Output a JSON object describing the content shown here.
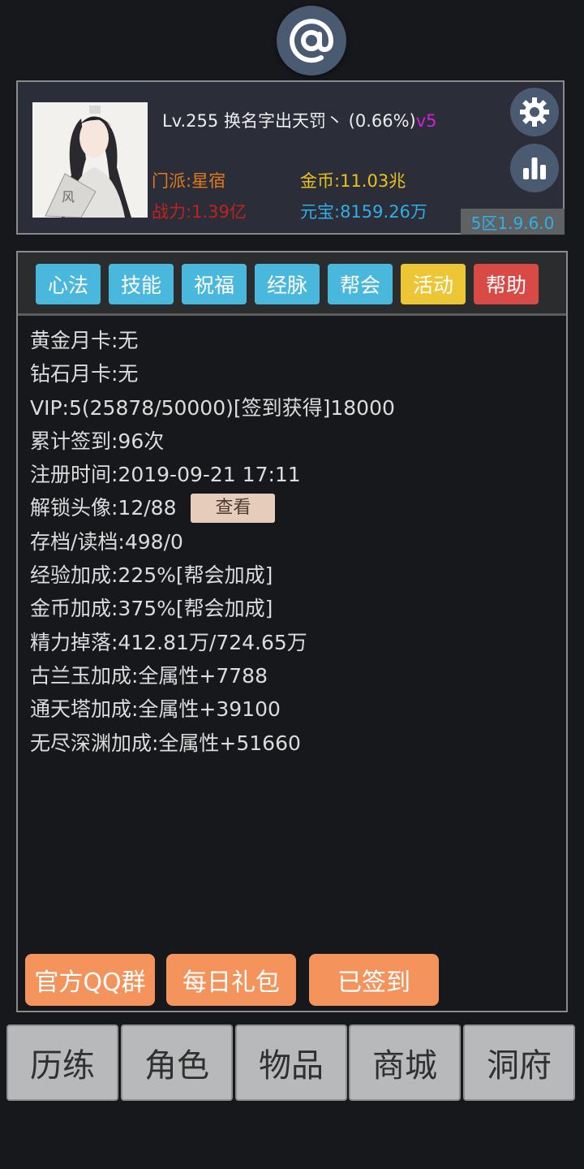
{
  "header": {
    "top_icon": "at-sign-icon"
  },
  "profile": {
    "level": "Lv.255",
    "name": "换名字出天罚丶",
    "progress": "(0.66%)",
    "vip": "v5",
    "sect": "门派:星宿",
    "gold": "金币:11.03兆",
    "power": "战力:1.39亿",
    "yuanbao": "元宝:8159.26万",
    "version": "5区1.9.6.0",
    "settings_icon": "gear-icon",
    "stats_icon": "bar-chart-icon",
    "avatar_fan_char": "风"
  },
  "tabs": [
    {
      "label": "心法",
      "color": "#4ab8dc"
    },
    {
      "label": "技能",
      "color": "#4ab8dc"
    },
    {
      "label": "祝福",
      "color": "#4ab8dc"
    },
    {
      "label": "经脉",
      "color": "#4ab8dc"
    },
    {
      "label": "帮会",
      "color": "#4ab8dc"
    },
    {
      "label": "活动",
      "color": "#ecc634"
    },
    {
      "label": "帮助",
      "color": "#d84a45"
    }
  ],
  "info": [
    "黄金月卡:无",
    "钻石月卡:无",
    "VIP:5(25878/50000)[签到获得]18000",
    "累计签到:96次",
    "注册时间:2019-09-21 17:11",
    "解锁头像:12/88",
    "存档/读档:498/0",
    "经验加成:225%[帮会加成]",
    "金币加成:375%[帮会加成]",
    "精力掉落:412.81万/724.65万",
    "古兰玉加成:全属性+7788",
    "通天塔加成:全属性+39100",
    "无尽深渊加成:全属性+51660"
  ],
  "view_button": "查看",
  "actions": {
    "qq_group": "官方QQ群",
    "daily_gift": "每日礼包",
    "signed_in": "已签到"
  },
  "nav": [
    "历练",
    "角色",
    "物品",
    "商城",
    "洞府"
  ]
}
